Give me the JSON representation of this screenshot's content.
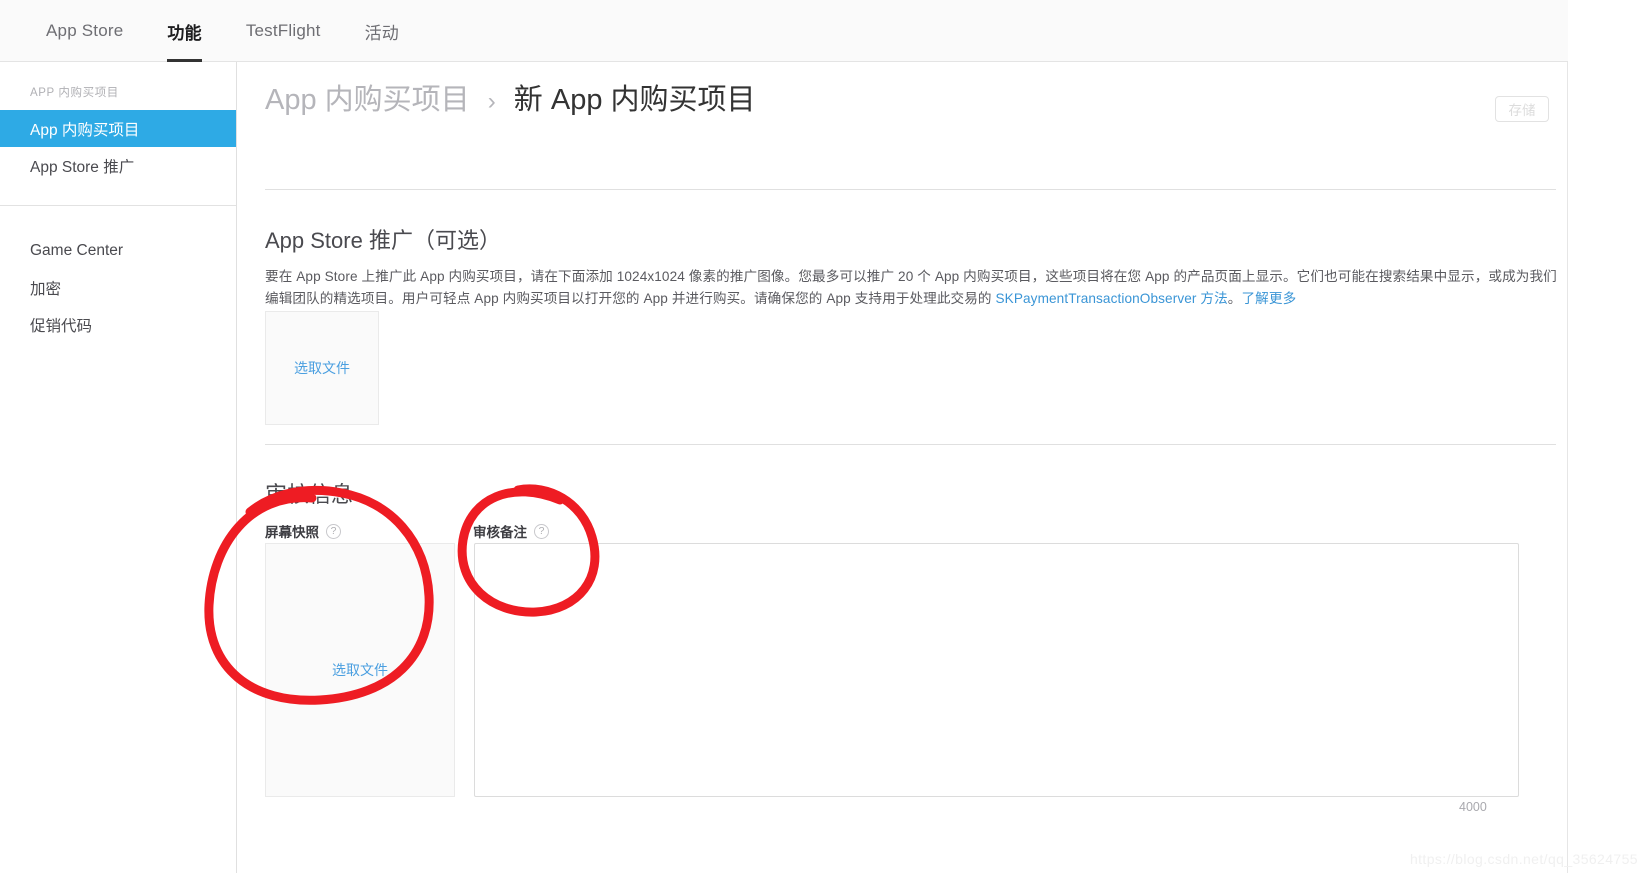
{
  "topnav": {
    "items": [
      {
        "label": "App Store",
        "active": false
      },
      {
        "label": "功能",
        "active": true
      },
      {
        "label": "TestFlight",
        "active": false
      },
      {
        "label": "活动",
        "active": false
      }
    ]
  },
  "sidebar": {
    "section_title": "APP 内购买项目",
    "group1": [
      {
        "label": "App 内购买项目",
        "active": true
      },
      {
        "label": "App Store 推广",
        "active": false
      }
    ],
    "group2": [
      {
        "label": "Game Center",
        "active": false
      },
      {
        "label": "加密",
        "active": false
      },
      {
        "label": "促销代码",
        "active": false
      }
    ]
  },
  "header": {
    "breadcrumb_parent": "App 内购买项目",
    "breadcrumb_separator": "›",
    "breadcrumb_current": "新 App 内购买项目",
    "save_label": "存储"
  },
  "promo_section": {
    "title": "App Store 推广（可选）",
    "description_part1": "要在 App Store 上推广此 App 内购买项目，请在下面添加 1024x1024 像素的推广图像。您最多可以推广 20 个 App 内购买项目，这些项目将在您 App 的产品页面上显示。它们也可能在搜索结果中显示，或成为我们编辑团队的精选项目。用户可轻点 App 内购买项目以打开您的 App 并进行购买。请确保您的 App 支持用于处理此交易的 ",
    "link_sdk": "SKPaymentTransactionObserver 方法",
    "description_part2": "。",
    "link_more": "了解更多",
    "choose_file_label": "选取文件"
  },
  "review_section": {
    "title": "审核信息",
    "screenshot_label": "屏幕快照",
    "screenshot_help": "?",
    "notes_label": "审核备注",
    "notes_help": "?",
    "choose_file_label": "选取文件",
    "notes_value": "",
    "notes_placeholder": "",
    "char_limit": "4000"
  },
  "annotations": {
    "color": "#ee1c23",
    "shapes": [
      "circle-around-screenshot-field",
      "circle-around-review-notes-label"
    ]
  },
  "watermark": {
    "text": "https://blog.csdn.net/qq_35624755"
  }
}
